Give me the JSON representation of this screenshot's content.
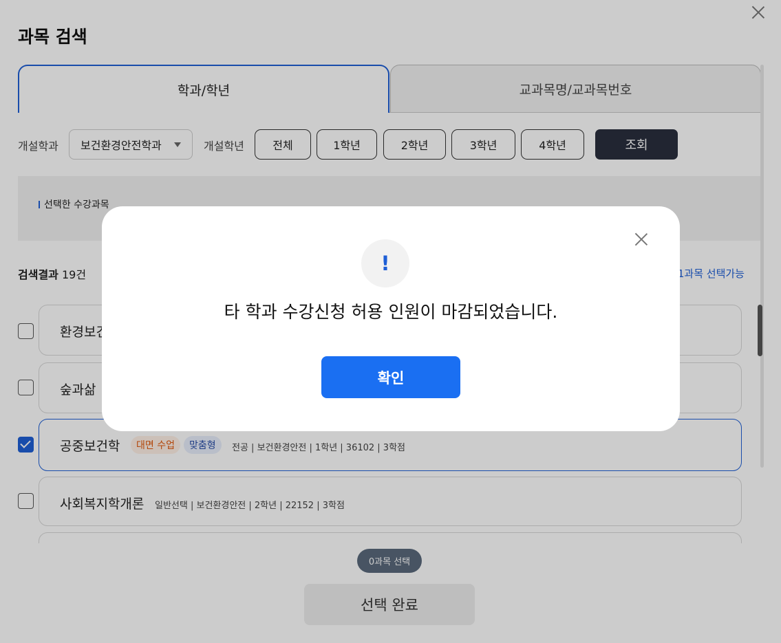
{
  "page_title": "과목 검색",
  "tabs": [
    {
      "label": "학과/학년",
      "active": true
    },
    {
      "label": "교과목명/교과목번호",
      "active": false
    }
  ],
  "filters": {
    "dept_label": "개설학과",
    "dept_value": "보건환경안전학과",
    "grade_label": "개설학년",
    "grades": [
      "전체",
      "1학년",
      "2학년",
      "3학년",
      "4학년"
    ],
    "search_button": "조회"
  },
  "selected_panel": {
    "title": "선택한 수강과목"
  },
  "results": {
    "label": "검색결과",
    "count": "19건",
    "limit_text": "1과목 선택가능"
  },
  "rows": [
    {
      "name": "환경보건",
      "checked": false
    },
    {
      "name": "숲과삶",
      "checked": false
    },
    {
      "name": "공중보건학",
      "checked": true,
      "badges": [
        "대면 수업",
        "맞춤형"
      ],
      "meta": "전공 | 보건환경안전 | 1학년 | 36102 | 3학점"
    },
    {
      "name": "사회복지학개론",
      "checked": false,
      "meta": "일반선택 | 보건환경안전 | 2학년 | 22152 | 3학점"
    }
  ],
  "selection_count": "0과목 선택",
  "done_button": "선택 완료",
  "modal": {
    "icon": "!",
    "message": "타 학과 수강신청 허용 인원이 마감되었습니다.",
    "confirm": "확인"
  },
  "colors": {
    "accent": "#1e5fd6",
    "confirm": "#1a6ff2",
    "dark_button": "#2a2f3e",
    "badge_orange": "#e05a10"
  }
}
